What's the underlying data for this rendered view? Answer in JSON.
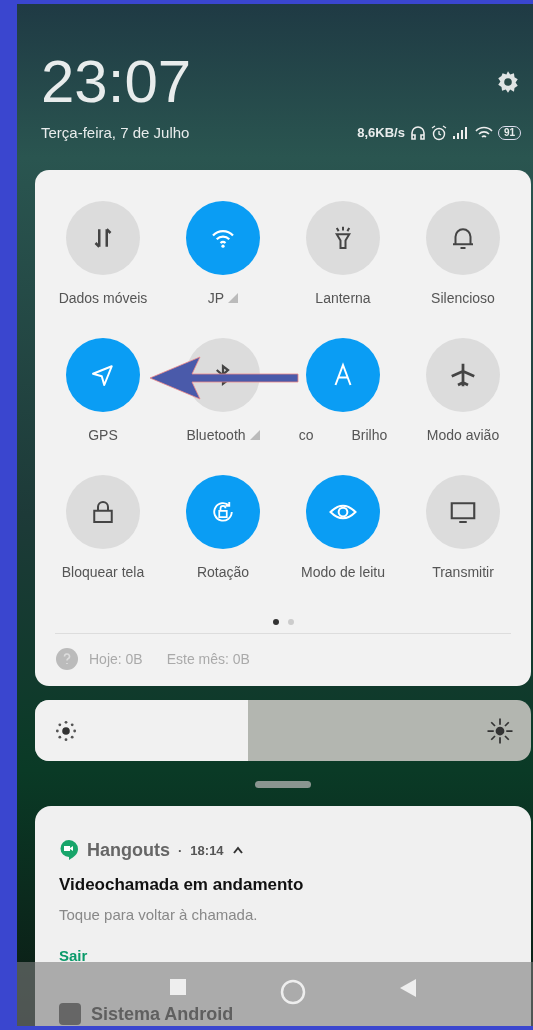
{
  "header": {
    "time": "23:07",
    "date": "Terça-feira, 7 de Julho",
    "net_speed": "8,6KB/s",
    "battery": "91"
  },
  "toggles": [
    {
      "label": "Dados móveis",
      "on": false,
      "signal": false
    },
    {
      "label": "JP",
      "on": true,
      "signal": true
    },
    {
      "label": "Lanterna",
      "on": false,
      "signal": false
    },
    {
      "label": "Silencioso",
      "on": false,
      "signal": false
    },
    {
      "label": "GPS",
      "on": true,
      "signal": false
    },
    {
      "label": "Bluetooth",
      "on": false,
      "signal": true
    },
    {
      "prefix": "co",
      "label": "Brilho",
      "on": true,
      "signal": false
    },
    {
      "label": "Modo avião",
      "on": false,
      "signal": false
    },
    {
      "label": "Bloquear tela",
      "on": false,
      "signal": false
    },
    {
      "label": "Rotação",
      "on": true,
      "signal": false
    },
    {
      "label": "Modo de leitu",
      "on": true,
      "signal": false
    },
    {
      "label": "Transmitir",
      "on": false,
      "signal": false
    }
  ],
  "pages": [
    {
      "selected": true
    },
    {
      "selected": false
    }
  ],
  "data_usage": {
    "today": "Hoje: 0B",
    "month": "Este mês: 0B"
  },
  "brightness": {
    "level": 0.43
  },
  "notification": {
    "app": "Hangouts",
    "separator": "·",
    "time": "18:14",
    "expanded": true,
    "title": "Videochamada em andamento",
    "text": "Toque para voltar à chamada.",
    "action": "Sair"
  },
  "next_notification": {
    "app": "Sistema Android"
  }
}
